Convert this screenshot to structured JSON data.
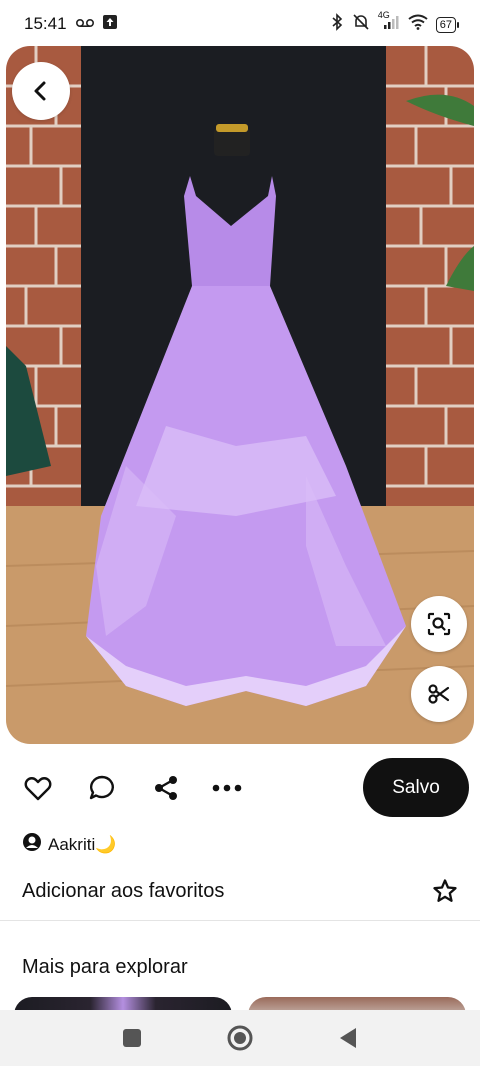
{
  "status_bar": {
    "time": "15:41",
    "voicemail_icon": "voicemail-icon",
    "upload_icon": "upload-icon",
    "network": "4G",
    "battery": "67"
  },
  "pin": {
    "image_description_icon": "dress-photo",
    "actions": {
      "like_icon": "heart-icon",
      "comment_icon": "comment-icon",
      "share_icon": "share-icon",
      "more_icon": "more-icon",
      "save_label": "Salvo"
    },
    "creator_name": "Aakriti🌙",
    "favorites_label": "Adicionar aos favoritos"
  },
  "explore": {
    "title": "Mais para explorar"
  },
  "colors": {
    "accent": "#111111",
    "dress": "#c49af0",
    "brick": "#a4553c",
    "floor": "#c99a6a"
  }
}
